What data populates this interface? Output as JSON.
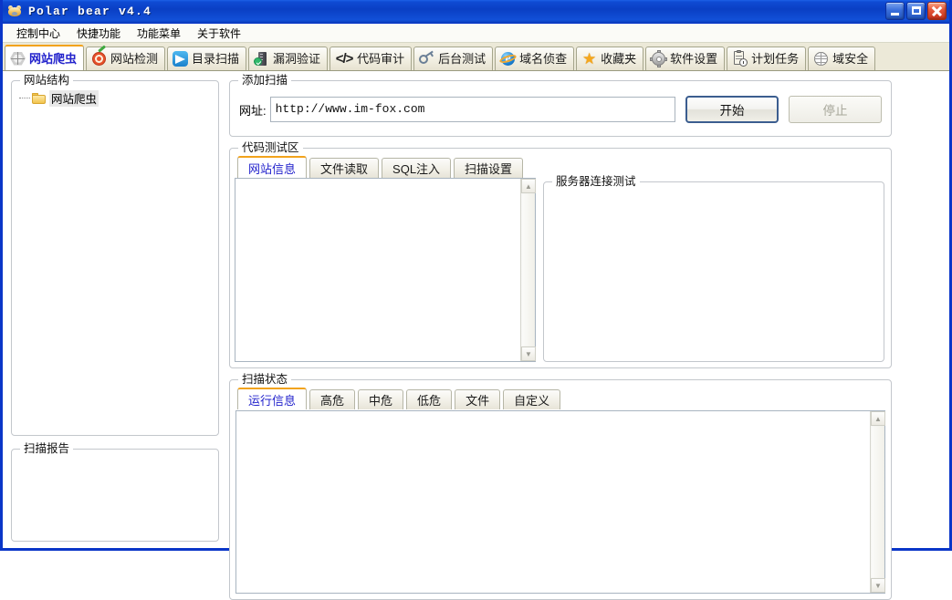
{
  "window": {
    "title": "Polar bear v4.4",
    "icon": "bear-icon",
    "controls": {
      "minimize": "minimize-button",
      "maximize": "maximize-button",
      "close": "close-button"
    }
  },
  "menubar": {
    "items": [
      {
        "label": "控制中心"
      },
      {
        "label": "快捷功能"
      },
      {
        "label": "功能菜单"
      },
      {
        "label": "关于软件"
      }
    ]
  },
  "toolbar": {
    "tabs": [
      {
        "label": "网站爬虫",
        "icon": "spider-web-icon",
        "active": true
      },
      {
        "label": "网站检测",
        "icon": "target-icon",
        "active": false
      },
      {
        "label": "目录扫描",
        "icon": "paper-plane-icon",
        "active": false
      },
      {
        "label": "漏洞验证",
        "icon": "server-check-icon",
        "active": false
      },
      {
        "label": "代码审计",
        "icon": "code-brackets-icon",
        "active": false
      },
      {
        "label": "后台测试",
        "icon": "key-icon",
        "active": false
      },
      {
        "label": "域名侦查",
        "icon": "internet-explorer-icon",
        "active": false
      },
      {
        "label": "收藏夹",
        "icon": "star-icon",
        "active": false
      },
      {
        "label": "软件设置",
        "icon": "gear-icon",
        "active": false
      },
      {
        "label": "计划任务",
        "icon": "clipboard-clock-icon",
        "active": false
      },
      {
        "label": "域安全",
        "icon": "globe-icon",
        "active": false
      }
    ]
  },
  "sidebar": {
    "structure": {
      "legend": "网站结构",
      "tree": [
        {
          "label": "网站爬虫",
          "icon": "folder-icon",
          "selected": true
        }
      ]
    },
    "report": {
      "legend": "扫描报告"
    }
  },
  "add_scan": {
    "legend": "添加扫描",
    "url_label": "网址:",
    "url_value": "http://www.im-fox.com",
    "url_placeholder": "",
    "start_button": "开始",
    "stop_button": "停止",
    "stop_disabled": true
  },
  "code_test": {
    "legend": "代码测试区",
    "tabs": [
      {
        "label": "网站信息",
        "active": true
      },
      {
        "label": "文件读取",
        "active": false
      },
      {
        "label": "SQL注入",
        "active": false
      },
      {
        "label": "扫描设置",
        "active": false
      }
    ],
    "server_test": {
      "legend": "服务器连接测试",
      "content": ""
    },
    "list_content": ""
  },
  "scan_status": {
    "legend": "扫描状态",
    "tabs": [
      {
        "label": "运行信息",
        "active": true
      },
      {
        "label": "高危",
        "active": false
      },
      {
        "label": "中危",
        "active": false
      },
      {
        "label": "低危",
        "active": false
      },
      {
        "label": "文件",
        "active": false
      },
      {
        "label": "自定义",
        "active": false
      }
    ],
    "log_content": ""
  },
  "colors": {
    "titlebar": "#0a3fc4",
    "window_border": "#0a36c8",
    "toolbar_bg": "#ece9d8",
    "active_tab_text": "#2222cc",
    "active_tab_accent": "#f2a31c"
  }
}
